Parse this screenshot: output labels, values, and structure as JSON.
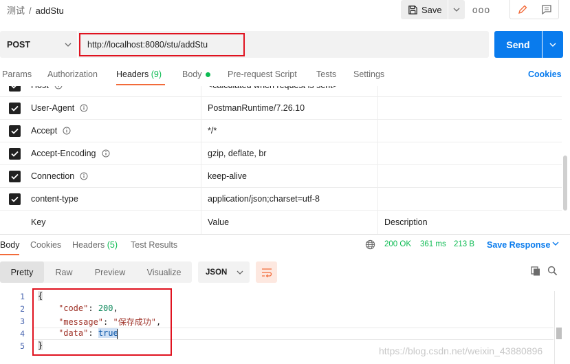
{
  "breadcrumb": {
    "parent": "测试",
    "separator": "/",
    "current": "addStu"
  },
  "toolbar": {
    "save_label": "Save",
    "more_label": "ooo"
  },
  "request": {
    "method": "POST",
    "url": "http://localhost:8080/stu/addStu",
    "send_label": "Send"
  },
  "request_tabs": {
    "params": "Params",
    "authorization": "Authorization",
    "headers": "Headers",
    "headers_count": "(9)",
    "body": "Body",
    "prerequest": "Pre-request Script",
    "tests": "Tests",
    "settings": "Settings",
    "cookies": "Cookies"
  },
  "headers": [
    {
      "key": "Host",
      "value": "<calculated when request is sent>",
      "checked": true,
      "info": true
    },
    {
      "key": "User-Agent",
      "value": "PostmanRuntime/7.26.10",
      "checked": true,
      "info": true
    },
    {
      "key": "Accept",
      "value": "*/*",
      "checked": true,
      "info": true
    },
    {
      "key": "Accept-Encoding",
      "value": "gzip, deflate, br",
      "checked": true,
      "info": true
    },
    {
      "key": "Connection",
      "value": "keep-alive",
      "checked": true,
      "info": true
    },
    {
      "key": "content-type",
      "value": "application/json;charset=utf-8",
      "checked": true,
      "info": false
    }
  ],
  "headers_placeholder": {
    "key": "Key",
    "value": "Value",
    "description": "Description"
  },
  "response_tabs": {
    "body": "Body",
    "cookies": "Cookies",
    "headers": "Headers",
    "headers_count": "(5)",
    "test_results": "Test Results"
  },
  "response_status": {
    "status": "200 OK",
    "time": "361 ms",
    "size": "213 B",
    "save_response": "Save Response"
  },
  "view_modes": {
    "pretty": "Pretty",
    "raw": "Raw",
    "preview": "Preview",
    "visualize": "Visualize",
    "format": "JSON"
  },
  "code_lines": {
    "l1": "1",
    "l2": "2",
    "l3": "3",
    "l4": "4",
    "l5": "5",
    "open": "{",
    "code_key": "\"code\"",
    "code_val": "200",
    "message_key": "\"message\"",
    "message_val": "\"保存成功\"",
    "data_key": "\"data\"",
    "data_val": "true",
    "close": "}"
  },
  "watermark": "https://blog.csdn.net/weixin_43880896",
  "colors": {
    "accent_blue": "#097bed",
    "status_green": "#0cbb52",
    "tab_orange": "#f26b3a",
    "highlight_red": "#e0121f"
  }
}
